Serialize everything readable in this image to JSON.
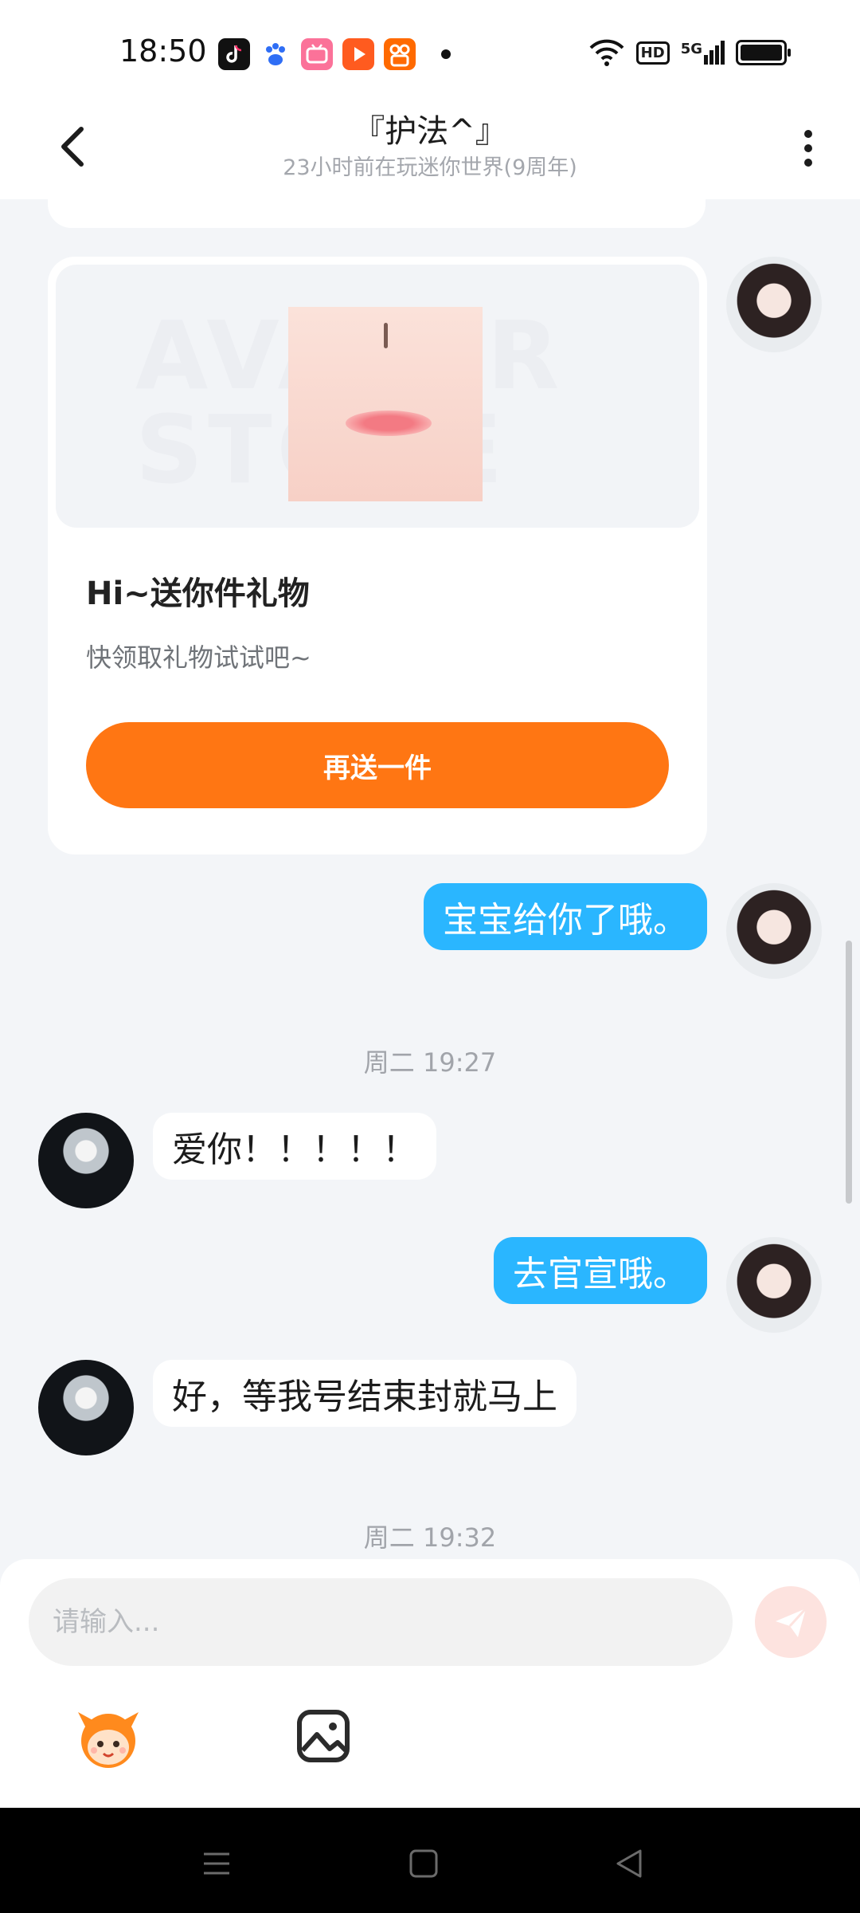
{
  "status_bar": {
    "time": "18:50",
    "network_label": "5G",
    "hd_label": "HD",
    "app_icons": [
      "tiktok-icon",
      "baidu-icon",
      "bilibili-icon",
      "video-player-icon",
      "kuaishou-icon"
    ]
  },
  "header": {
    "title": "『护法^』",
    "subtitle": "23小时前在玩迷你世界(9周年)"
  },
  "gift_card": {
    "watermark": "AVATAR STORE",
    "title": "Hi~送你件礼物",
    "subtitle": "快领取礼物试试吧~",
    "button_label": "再送一件"
  },
  "messages": [
    {
      "side": "me",
      "text": "宝宝给你了哦。"
    },
    {
      "type": "timestamp",
      "text": "周二 19:27"
    },
    {
      "side": "peer",
      "text": "爱你！！！！！"
    },
    {
      "side": "me",
      "text": "去官宣哦。"
    },
    {
      "side": "peer",
      "text": "好，等我号结束封就马上"
    },
    {
      "type": "timestamp",
      "text": "周二 19:32"
    }
  ],
  "input": {
    "placeholder": "请输入..."
  },
  "colors": {
    "accent_orange": "#ff7613",
    "my_bubble": "#2ab6ff",
    "background": "#f3f5f8"
  }
}
